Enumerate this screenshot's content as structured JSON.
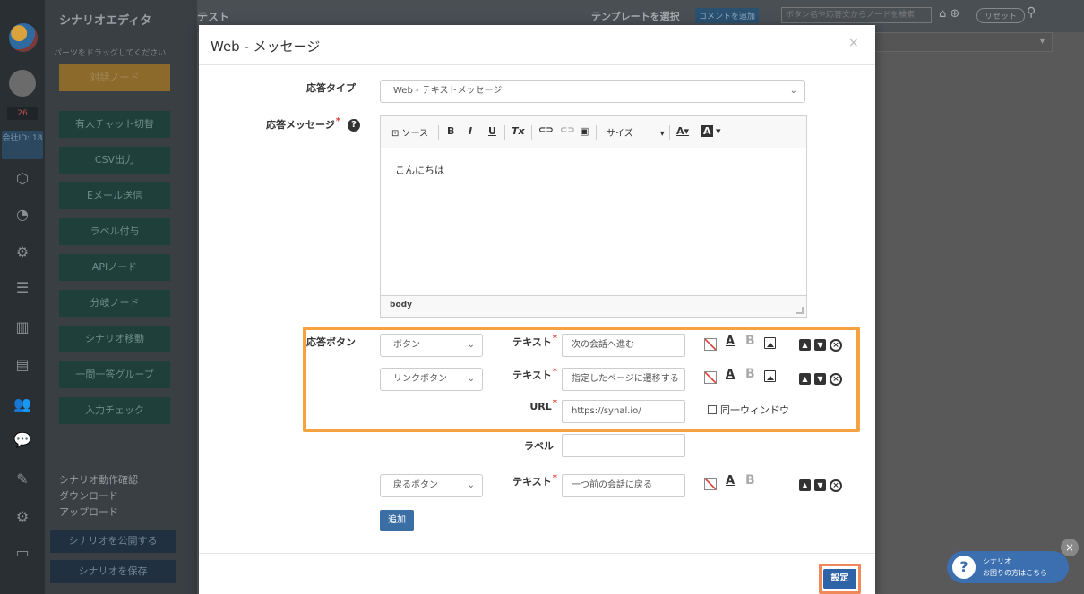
{
  "app": {
    "palette_title": "シナリオエディタ",
    "palette_hint": "パーツをドラッグしてください",
    "badge_count": "26",
    "company": "会社ID: 18",
    "nodes": [
      "対話ノード",
      "有人チャット切替",
      "CSV出力",
      "Eメール送信",
      "ラベル付与",
      "APIノード",
      "分岐ノード",
      "シナリオ移動",
      "一問一答グループ",
      "入力チェック"
    ],
    "links": [
      "シナリオ動作確認",
      "ダウンロード",
      "アップロード"
    ],
    "publish_label": "シナリオを公開する",
    "save_label": "シナリオを保存",
    "topbar": {
      "scenario_name": "テスト",
      "template_label": "テンプレートを選択",
      "add_comment": "コメントを追加",
      "search_placeholder": "ボタン名や応答文からノードを検索",
      "reset": "リセット"
    }
  },
  "modal": {
    "title": "Web - メッセージ",
    "close": "×",
    "response_type": {
      "label": "応答タイプ",
      "value": "Web - テキストメッセージ"
    },
    "response_message": {
      "label": "応答メッセージ",
      "toolbar": {
        "source": "ソース",
        "bold": "B",
        "italic": "I",
        "underline": "U",
        "clear": "Tx",
        "size": "サイズ",
        "font_color": "A",
        "bg_color": "A"
      },
      "body": "こんにちは",
      "path": "body"
    },
    "buttons_label": "応答ボタン",
    "text_label": "テキスト",
    "url_label": "URL",
    "label_label": "ラベル",
    "rows": [
      {
        "type": "ボタン",
        "text": "次の会話へ進む"
      },
      {
        "type": "リンクボタン",
        "text": "指定したページに遷移する",
        "url": "https://synal.io/",
        "same_window": "同一ウィンドウ"
      }
    ],
    "back_row": {
      "type": "戻るボタン",
      "text": "一つ前の会話に戻る"
    },
    "add_label": "追加",
    "submit_label": "設定"
  },
  "help_bubble": {
    "line1": "シナリオ",
    "line2": "お困りの方はこちら"
  }
}
